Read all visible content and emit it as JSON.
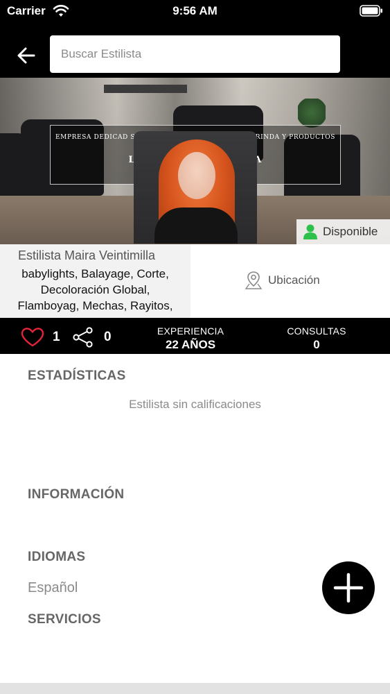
{
  "status_bar": {
    "carrier": "Carrier",
    "time": "9:56 AM",
    "icons": [
      "wifi-icon",
      "battery-icon"
    ]
  },
  "header": {
    "back_icon": "arrow-left-icon",
    "search_placeholder": "Buscar Estilista",
    "search_value": ""
  },
  "banner": {
    "promo_small": "EMPRESA DEDICAD                                          STILO Y TENDENCIAS. 17 AÑOS BRINDA                                               Y PRODUCTOS DE",
    "promo_big": "LA                                    D EN LA I                                  BELLEZA",
    "availability": "Disponible",
    "availability_icon": "person-icon",
    "availability_color": "#2ec04a"
  },
  "profile": {
    "name": "Estilista Maira Veintimilla",
    "skills": [
      "babylights, Balayage, Corte,",
      "Decoloración Global,",
      "Flamboyag, Mechas, Rayitos,"
    ],
    "location_label": "Ubicación",
    "location_icon": "map-pin-icon"
  },
  "stats_bar": {
    "likes": "1",
    "likes_icon": "heart-icon",
    "likes_color": "#e0243a",
    "shares": "0",
    "share_icon": "share-icon",
    "experience_title": "EXPERIENCIA",
    "experience_value": "22 AÑOS",
    "consultations_title": "CONSULTAS",
    "consultations_value": "0"
  },
  "sections": {
    "stats_title": "ESTADÍSTICAS",
    "no_ratings": "Estilista sin calificaciones",
    "info_title": "INFORMACIÓN",
    "languages_title": "IDIOMAS",
    "language": "Español",
    "services_title": "SERVICIOS"
  },
  "fab": {
    "icon": "plus-icon"
  }
}
